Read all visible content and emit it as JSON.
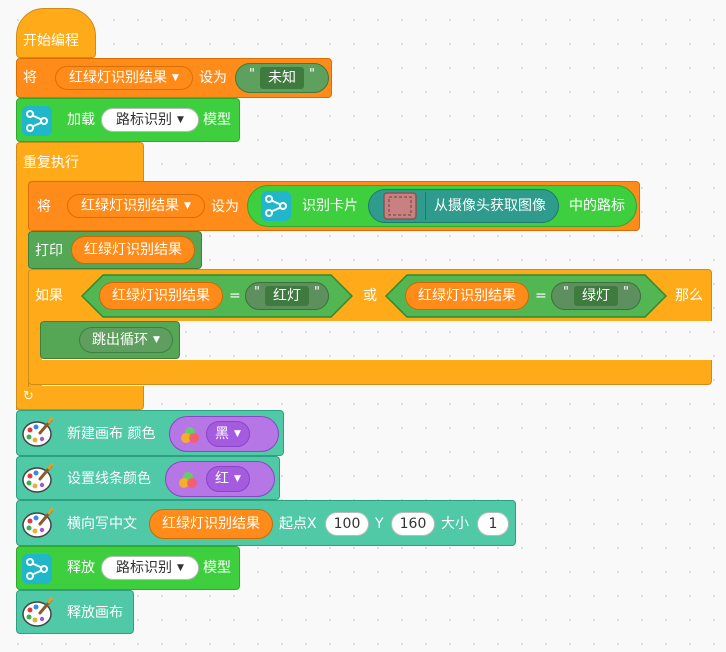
{
  "script": {
    "start": {
      "label": "开始编程"
    },
    "set_var_1": {
      "prefix": "将",
      "var": "红绿灯识别结果",
      "mid": "设为",
      "value": "未知"
    },
    "load_model": {
      "prefix": "加载",
      "model": "路标识别",
      "suffix": "模型"
    },
    "repeat": {
      "label": "重复执行"
    },
    "set_var_2": {
      "prefix": "将",
      "var": "红绿灯识别结果",
      "mid": "设为",
      "reporter_label": "识别卡片",
      "camera_text": "从摄像头获取图像",
      "suffix": "中的路标"
    },
    "print": {
      "prefix": "打印",
      "var": "红绿灯识别结果"
    },
    "if": {
      "prefix": "如果",
      "left_var": "红绿灯识别结果",
      "eq1": "=",
      "left_value": "红灯",
      "or": "或",
      "right_var": "红绿灯识别结果",
      "eq2": "=",
      "right_value": "绿灯",
      "then": "那么"
    },
    "break": {
      "label": "跳出循环"
    },
    "new_canvas": {
      "label": "新建画布 颜色",
      "color": "黑"
    },
    "set_line_color": {
      "label": "设置线条颜色",
      "color": "红"
    },
    "write_text": {
      "label": "横向写中文",
      "var": "红绿灯识别结果",
      "x_label": "起点X",
      "x": "100",
      "y_label": "Y",
      "y": "160",
      "size_label": "大小",
      "size": "1"
    },
    "release_model": {
      "prefix": "释放",
      "model": "路标识别",
      "suffix": "模型"
    },
    "release_canvas": {
      "label": "释放画布"
    }
  },
  "colors": {
    "control": "#ffab19",
    "variables": "#ff8c1a",
    "ai": "#3ecf3e",
    "pen": "#4fc9a6",
    "color_dropdown": "#a55be0"
  },
  "icons": [
    "neural-network-icon",
    "palette-icon",
    "repeat-arrow-icon",
    "color-circles-icon",
    "camera-frame-icon",
    "dropdown-caret-icon"
  ]
}
